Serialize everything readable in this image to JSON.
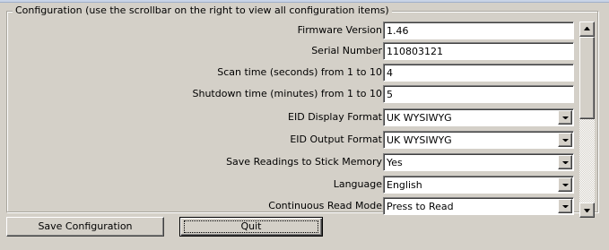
{
  "group": {
    "title": "Configuration (use the scrollbar on the right to view all configuration items)"
  },
  "fields": [
    {
      "label": "Firmware Version",
      "value": "1.46",
      "type": "text"
    },
    {
      "label": "Serial Number",
      "value": "110803121",
      "type": "text"
    },
    {
      "label": "Scan time (seconds) from 1 to 10",
      "value": "4",
      "type": "text"
    },
    {
      "label": "Shutdown time (minutes) from 1 to 10",
      "value": "5",
      "type": "text"
    },
    {
      "label": "EID Display Format",
      "value": "UK WYSIWYG",
      "type": "select"
    },
    {
      "label": "EID Output Format",
      "value": "UK WYSIWYG",
      "type": "select"
    },
    {
      "label": "Save Readings to Stick Memory",
      "value": "Yes",
      "type": "select"
    },
    {
      "label": "Language",
      "value": "English",
      "type": "select"
    },
    {
      "label": "Continuous Read Mode",
      "value": "Press to Read",
      "type": "select"
    }
  ],
  "buttons": {
    "save_label": "Save Configuration",
    "quit_label": "Quit"
  },
  "colors": {
    "dialog_background": "#d4d0c8",
    "field_background": "#ffffff"
  }
}
